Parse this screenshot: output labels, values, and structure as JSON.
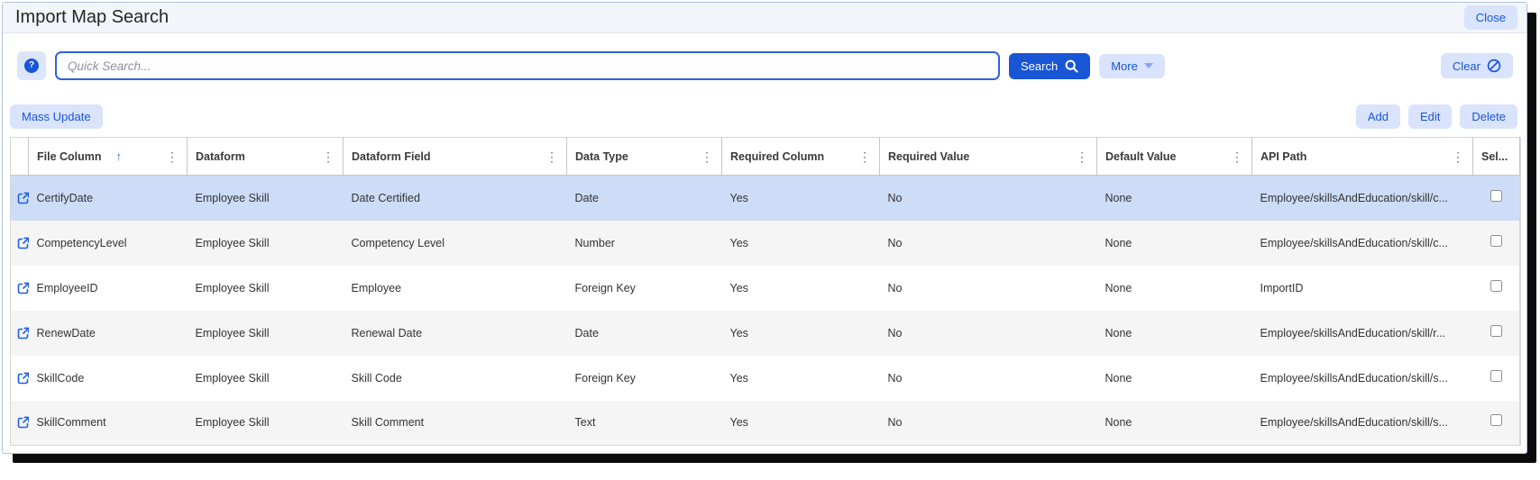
{
  "window": {
    "title": "Import Map Search",
    "close_button": "Close"
  },
  "search": {
    "placeholder": "Quick Search...",
    "value": "",
    "search_button": "Search",
    "more_button": "More",
    "clear_button": "Clear"
  },
  "toolbar": {
    "mass_update_button": "Mass Update",
    "add_button": "Add",
    "edit_button": "Edit",
    "delete_button": "Delete"
  },
  "table": {
    "columns": [
      "File Column",
      "Dataform",
      "Dataform Field",
      "Data Type",
      "Required Column",
      "Required Value",
      "Default Value",
      "API Path",
      "Sel..."
    ],
    "sort": {
      "column": "File Column",
      "direction": "ascending",
      "indicator": "↑"
    },
    "rows": [
      {
        "file_column": "CertifyDate",
        "dataform": "Employee Skill",
        "dataform_field": "Date Certified",
        "data_type": "Date",
        "required_column": "Yes",
        "required_value": "No",
        "default_value": "None",
        "api_path": "Employee/skillsAndEducation/skill/c...",
        "selected": true,
        "checkbox_checked": false
      },
      {
        "file_column": "CompetencyLevel",
        "dataform": "Employee Skill",
        "dataform_field": "Competency Level",
        "data_type": "Number",
        "required_column": "Yes",
        "required_value": "No",
        "default_value": "None",
        "api_path": "Employee/skillsAndEducation/skill/c...",
        "selected": false,
        "checkbox_checked": false
      },
      {
        "file_column": "EmployeeID",
        "dataform": "Employee Skill",
        "dataform_field": "Employee",
        "data_type": "Foreign Key",
        "required_column": "Yes",
        "required_value": "No",
        "default_value": "None",
        "api_path": "ImportID",
        "selected": false,
        "checkbox_checked": false
      },
      {
        "file_column": "RenewDate",
        "dataform": "Employee Skill",
        "dataform_field": "Renewal Date",
        "data_type": "Date",
        "required_column": "Yes",
        "required_value": "No",
        "default_value": "None",
        "api_path": "Employee/skillsAndEducation/skill/r...",
        "selected": false,
        "checkbox_checked": false
      },
      {
        "file_column": "SkillCode",
        "dataform": "Employee Skill",
        "dataform_field": "Skill Code",
        "data_type": "Foreign Key",
        "required_column": "Yes",
        "required_value": "No",
        "default_value": "None",
        "api_path": "Employee/skillsAndEducation/skill/s...",
        "selected": false,
        "checkbox_checked": false
      },
      {
        "file_column": "SkillComment",
        "dataform": "Employee Skill",
        "dataform_field": "Skill Comment",
        "data_type": "Text",
        "required_column": "Yes",
        "required_value": "No",
        "default_value": "None",
        "api_path": "Employee/skillsAndEducation/skill/s...",
        "selected": false,
        "checkbox_checked": false
      }
    ]
  },
  "colors": {
    "primary_blue": "#1956d6",
    "light_blue_button_bg": "#d9e3fb",
    "selected_row_bg": "#cddcf7",
    "stripe_row_bg": "#f5f5f5",
    "titlebar_bg": "#f2f5fa",
    "shadow": "#0b0b0b"
  },
  "icons": {
    "help": "question-circle",
    "search": "magnifier",
    "more": "chevron-down",
    "clear": "ban-circle",
    "row_open": "external-link",
    "column_menu": "kebab-vertical",
    "sort": "arrow-up"
  }
}
